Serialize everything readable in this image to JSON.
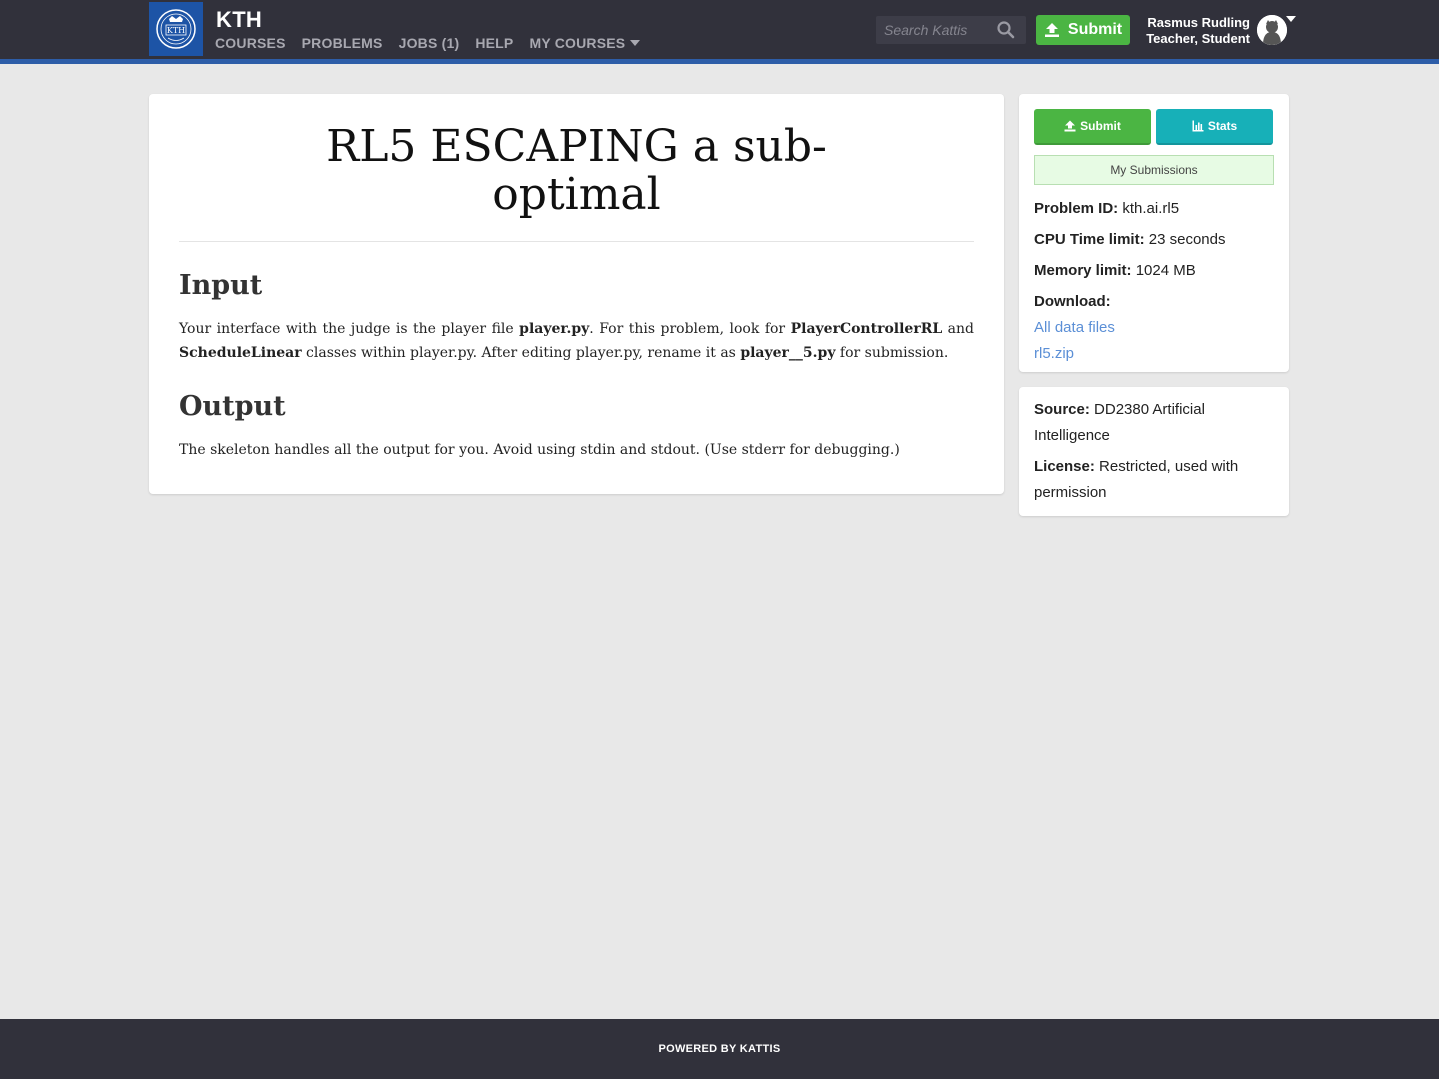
{
  "header": {
    "site_title": "KTH",
    "logo_alt": "KTH",
    "nav": [
      "COURSES",
      "PROBLEMS",
      "JOBS (1)",
      "HELP",
      "MY COURSES"
    ],
    "search_placeholder": "Search Kattis",
    "submit_label": "Submit",
    "user_name": "Rasmus Rudling",
    "user_roles": "Teacher, Student",
    "colors": {
      "bar": "#31313b",
      "accent": "#2d5da8",
      "submit": "#4bb543"
    }
  },
  "problem": {
    "title": "RL5 ESCAPING a sub-optimal",
    "input_heading": "Input",
    "input_text": {
      "p1": "Your interface with the judge is the player file ",
      "b1": "player.py",
      "p2": ". For this problem, look for ",
      "b2": "PlayerControllerRL",
      "p3": " and ",
      "b3": "ScheduleLinear",
      "p4": " classes within player.py. After editing player.py, rename it as ",
      "b4": "player__5.py",
      "p5": " for submission."
    },
    "output_heading": "Output",
    "output_text": "The skeleton handles all the output for you. Avoid using stdin and stdout. (Use stderr for debugging.)"
  },
  "sidebar": {
    "submit_label": "Submit",
    "stats_label": "Stats",
    "my_submissions_label": "My Submissions",
    "problem_id_label": "Problem ID:",
    "problem_id": "kth.ai.rl5",
    "cpu_label": "CPU Time limit:",
    "cpu_value": "23 seconds",
    "memory_label": "Memory limit:",
    "memory_value": "1024 MB",
    "download_label": "Download:",
    "downloads": [
      "All data files",
      "rl5.zip"
    ],
    "source_label": "Source:",
    "source_value": "DD2380 Artificial Intelligence",
    "license_label": "License:",
    "license_value": "Restricted, used with permission",
    "colors": {
      "submit": "#4bb543",
      "stats": "#17b0b8",
      "link": "#5b8fd6"
    }
  },
  "footer": {
    "text": "POWERED BY KATTIS"
  }
}
